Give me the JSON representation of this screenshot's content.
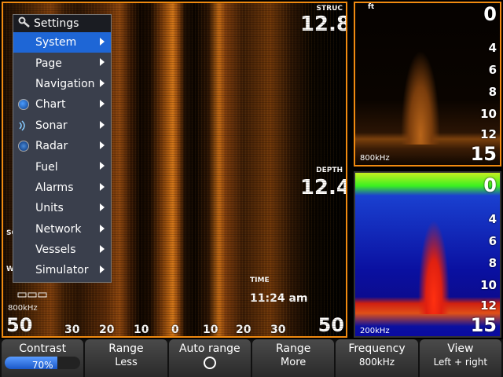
{
  "sidescan": {
    "struc_label": "STRUC",
    "struc_value": "12.8",
    "depth_label": "DEPTH",
    "depth_value": "12.4",
    "time_label": "TIME",
    "time_value": "11:24 am",
    "frequency": "800kHz",
    "range_left": "50",
    "range_right": "50",
    "ticks": [
      "30",
      "20",
      "10",
      "0",
      "10",
      "20",
      "30"
    ],
    "edge_label_so": "SO",
    "edge_label_w": "W"
  },
  "downscan": {
    "unit": "ft",
    "top_value": "0",
    "scale": [
      "4",
      "6",
      "8",
      "10",
      "12"
    ],
    "bottom_value": "15",
    "frequency": "800kHz"
  },
  "sonar2d": {
    "unit": "ft",
    "top_value": "0",
    "scale": [
      "4",
      "6",
      "8",
      "10",
      "12"
    ],
    "bottom_value": "15",
    "frequency": "200kHz"
  },
  "menu": {
    "title": "Settings",
    "items": [
      {
        "label": "System"
      },
      {
        "label": "Page"
      },
      {
        "label": "Navigation"
      },
      {
        "label": "Chart",
        "icon": "globe-icon"
      },
      {
        "label": "Sonar",
        "icon": "sonar-icon"
      },
      {
        "label": "Radar",
        "icon": "radar-icon"
      },
      {
        "label": "Fuel"
      },
      {
        "label": "Alarms"
      },
      {
        "label": "Units"
      },
      {
        "label": "Network"
      },
      {
        "label": "Vessels"
      },
      {
        "label": "Simulator"
      }
    ],
    "selected": "System"
  },
  "softkeys": [
    {
      "title": "Contrast",
      "value": "70%",
      "progress": 0.7
    },
    {
      "title": "Range",
      "value": "Less"
    },
    {
      "title": "Auto range",
      "value": ""
    },
    {
      "title": "Range",
      "value": "More"
    },
    {
      "title": "Frequency",
      "value": "800kHz"
    },
    {
      "title": "View",
      "value": "Left + right"
    }
  ],
  "colors": {
    "accent": "#f08a10",
    "selected": "#1e66d6",
    "contrast_bar": "#2a70e8"
  }
}
